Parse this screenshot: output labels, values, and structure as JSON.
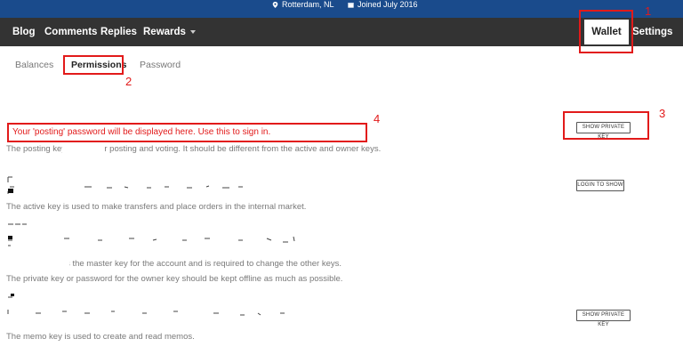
{
  "topbar": {
    "location": "Rotterdam, NL",
    "joined": "Joined July 2016"
  },
  "nav": {
    "blog": "Blog",
    "comments": "Comments",
    "replies": "Replies",
    "rewards": "Rewards",
    "wallet": "Wallet",
    "settings": "Settings"
  },
  "subtabs": {
    "balances": "Balances",
    "permissions": "Permissions",
    "password": "Password"
  },
  "annotations": {
    "n1": "1",
    "n2": "2",
    "n3": "3",
    "n4": "4",
    "color": "#e21a1a"
  },
  "keys": {
    "posting_notice": "Your 'posting' password will be displayed here. Use this to sign in.",
    "posting_desc": "The posting key is used for posting and voting. It should be different from the active and owner keys.",
    "active_desc": "The active key is used to make transfers and place orders in the internal market.",
    "owner_desc": "The owner key is the master key for the account and is required to change the other keys.",
    "owner_desc2": "The private key or password for the owner key should be kept offline as much as possible.",
    "memo_desc": "The memo key is used to create and read memos.",
    "show_private_key": "SHOW PRIVATE KEY",
    "login_to_show": "LOGIN TO SHOW",
    "show_private_key_memo": "SHOW PRIVATE KEY"
  },
  "colors": {
    "topbar": "#1a4b8c",
    "navbar": "#333333",
    "annotation": "#e21a1a"
  }
}
